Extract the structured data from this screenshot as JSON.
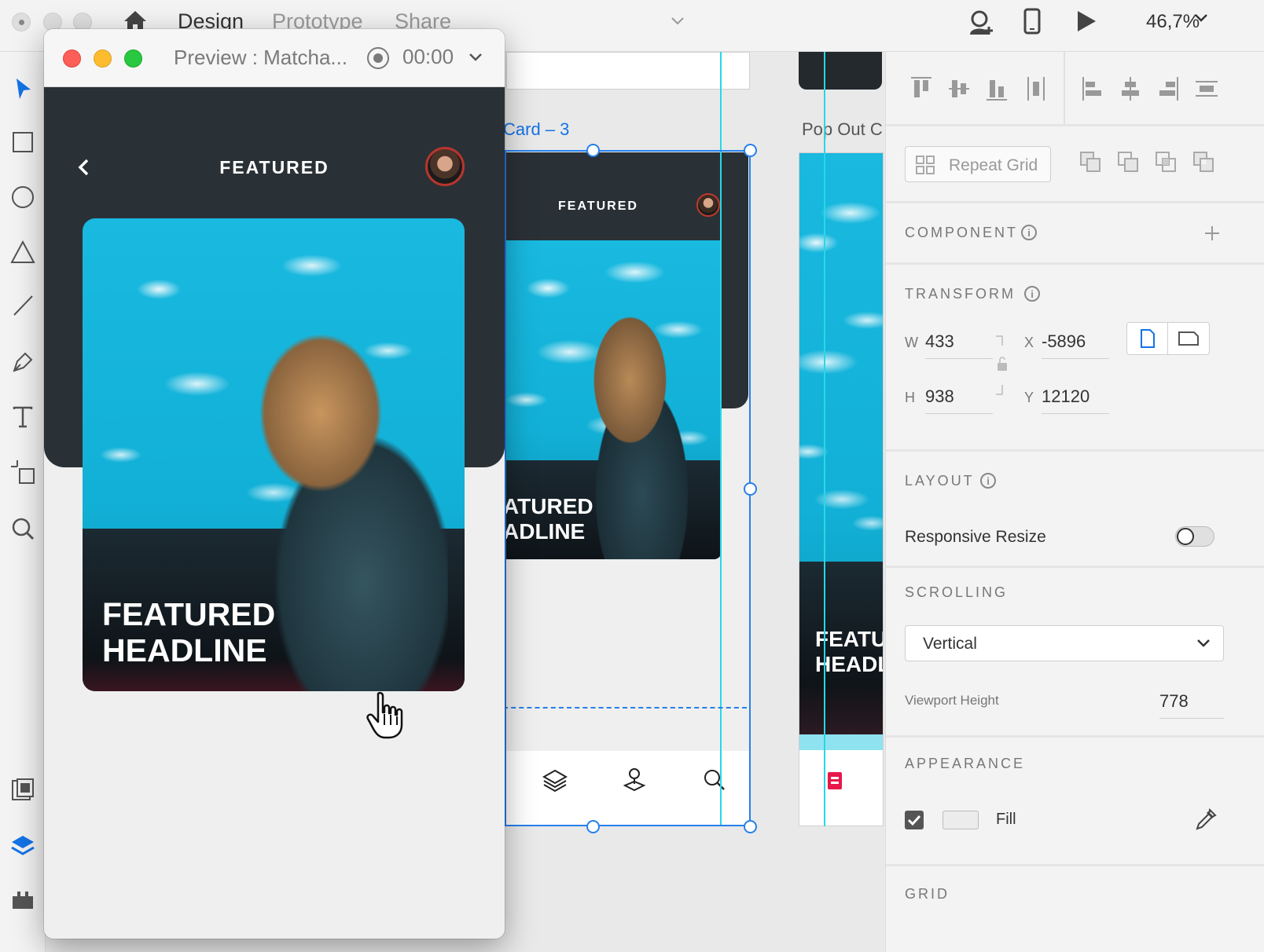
{
  "topbar": {
    "tabs": [
      {
        "label": "Design",
        "active": true
      },
      {
        "label": "Prototype",
        "active": false
      },
      {
        "label": "Share",
        "active": false
      }
    ],
    "zoom": "46,7%"
  },
  "canvas": {
    "artboard_labels": [
      "Card – 3",
      "Pop Out C"
    ],
    "artboard_nav_title": "FEATURED",
    "artboard_headline": [
      "ATURED",
      "ADLINE"
    ],
    "right_artboard_headline": [
      "FEATU",
      "HEADL"
    ]
  },
  "preview": {
    "title": "Preview : Matcha...",
    "timer": "00:00",
    "nav_title": "FEATURED",
    "headline_line1": "FEATURED",
    "headline_line2": "HEADLINE"
  },
  "panel": {
    "repeat_grid": "Repeat Grid",
    "component": {
      "title": "COMPONENT"
    },
    "transform": {
      "title": "TRANSFORM",
      "w_label": "W",
      "w": "433",
      "h_label": "H",
      "h": "938",
      "x_label": "X",
      "x": "-5896",
      "y_label": "Y",
      "y": "12120"
    },
    "layout": {
      "title": "LAYOUT",
      "responsive_label": "Responsive Resize",
      "responsive_on": false
    },
    "scrolling": {
      "title": "SCROLLING",
      "value": "Vertical",
      "viewport_label": "Viewport Height",
      "viewport_value": "778"
    },
    "appearance": {
      "title": "APPEARANCE",
      "fill_label": "Fill",
      "fill_checked": true
    },
    "grid": {
      "title": "GRID"
    }
  },
  "colors": {
    "accent_blue": "#1473e6",
    "selection_blue": "#2680eb",
    "guide_cyan": "#27d8e6",
    "dark_header": "#2a3136"
  }
}
